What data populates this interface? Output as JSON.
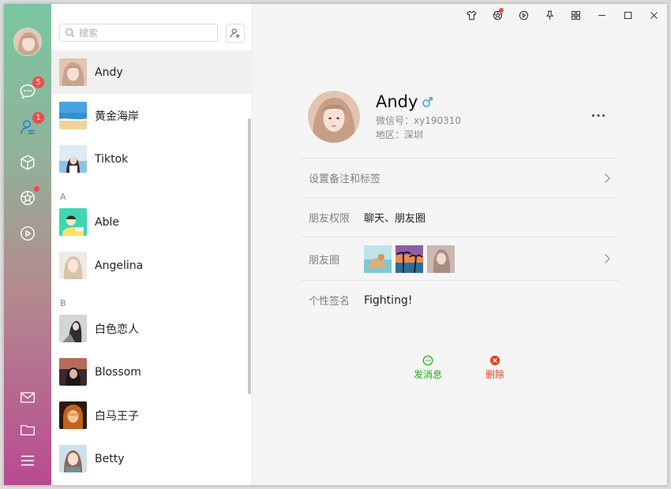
{
  "sidebar": {
    "message_badge": "5",
    "contacts_badge": "1"
  },
  "search": {
    "placeholder": "搜索"
  },
  "contacts": [
    {
      "name": "Andy",
      "selected": true
    },
    {
      "name": "黄金海岸"
    },
    {
      "name": "Tiktok"
    },
    {
      "letter": "A"
    },
    {
      "name": "Able"
    },
    {
      "name": "Angelina"
    },
    {
      "letter": "B"
    },
    {
      "name": "白色恋人"
    },
    {
      "name": "Blossom"
    },
    {
      "name": "白马王子"
    },
    {
      "name": "Betty"
    }
  ],
  "profile": {
    "name": "Andy",
    "wxid": "微信号：xy190310",
    "region": "地区：深圳"
  },
  "rows": {
    "remark_label": "设置备注和标签",
    "permission_label": "朋友权限",
    "permission_value": "聊天、朋友圈",
    "moments_label": "朋友圈",
    "signature_label": "个性签名",
    "signature_value": "Fighting!"
  },
  "actions": {
    "send_message": "发消息",
    "delete": "删除"
  },
  "colors": {
    "accent_green": "#1aad19",
    "delete_red": "#e8451e",
    "badge_red": "#f24949",
    "male_blue": "#3aa7e0"
  }
}
